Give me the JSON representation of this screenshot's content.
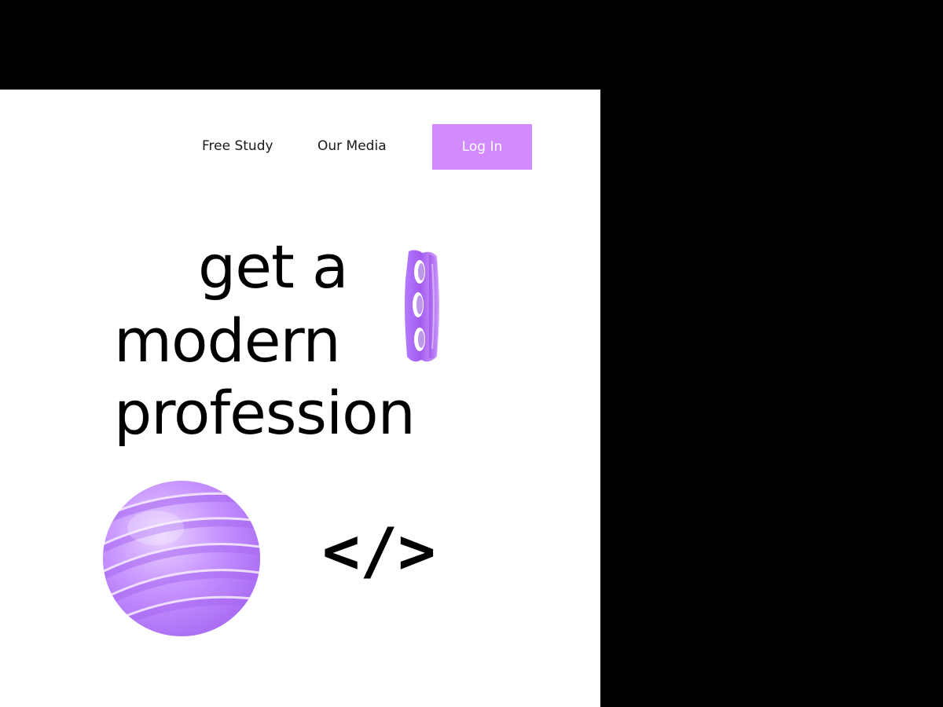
{
  "nav": {
    "free_study": "Free Study",
    "our_media": "Our Media",
    "login": "Log In"
  },
  "hero": {
    "line1": "get a",
    "line2": "modern",
    "line3": "profession",
    "code_symbol": "</>"
  },
  "icons": {
    "ring": "purple-3d-ring-icon",
    "sphere": "purple-3d-sphere-icon"
  },
  "colors": {
    "accent": "#d18bff",
    "background": "#ffffff",
    "frame": "#000000",
    "text": "#000000"
  }
}
